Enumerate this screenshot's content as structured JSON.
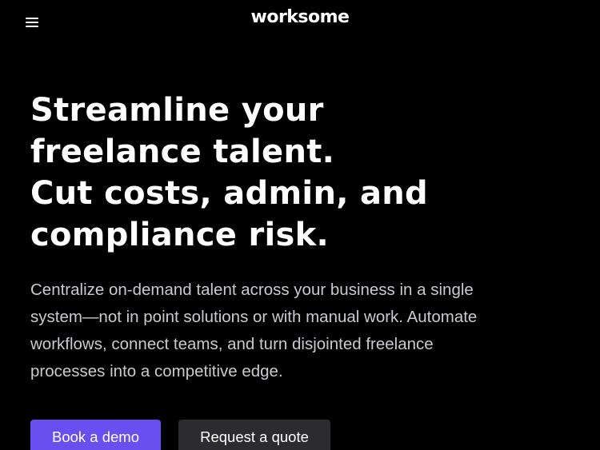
{
  "header": {
    "menu_icon": "hamburger-menu-icon",
    "logo_text": "worksome"
  },
  "hero": {
    "title_lines": [
      "Streamline your",
      "freelance talent.",
      "Cut costs, admin, and",
      "compliance risk."
    ],
    "description": "Centralize on-demand talent across your business in a single system—not in point solutions or with manual work. Automate workflows, connect teams, and turn disjointed freelance processes into a competitive edge."
  },
  "actions": {
    "primary_label": "Book a demo",
    "secondary_label": "Request a quote"
  },
  "colors": {
    "background": "#000000",
    "primary_button": "#6a4ff0",
    "secondary_button": "#2c2c2f",
    "text": "#ffffff",
    "muted_text": "#c9c9cf"
  }
}
